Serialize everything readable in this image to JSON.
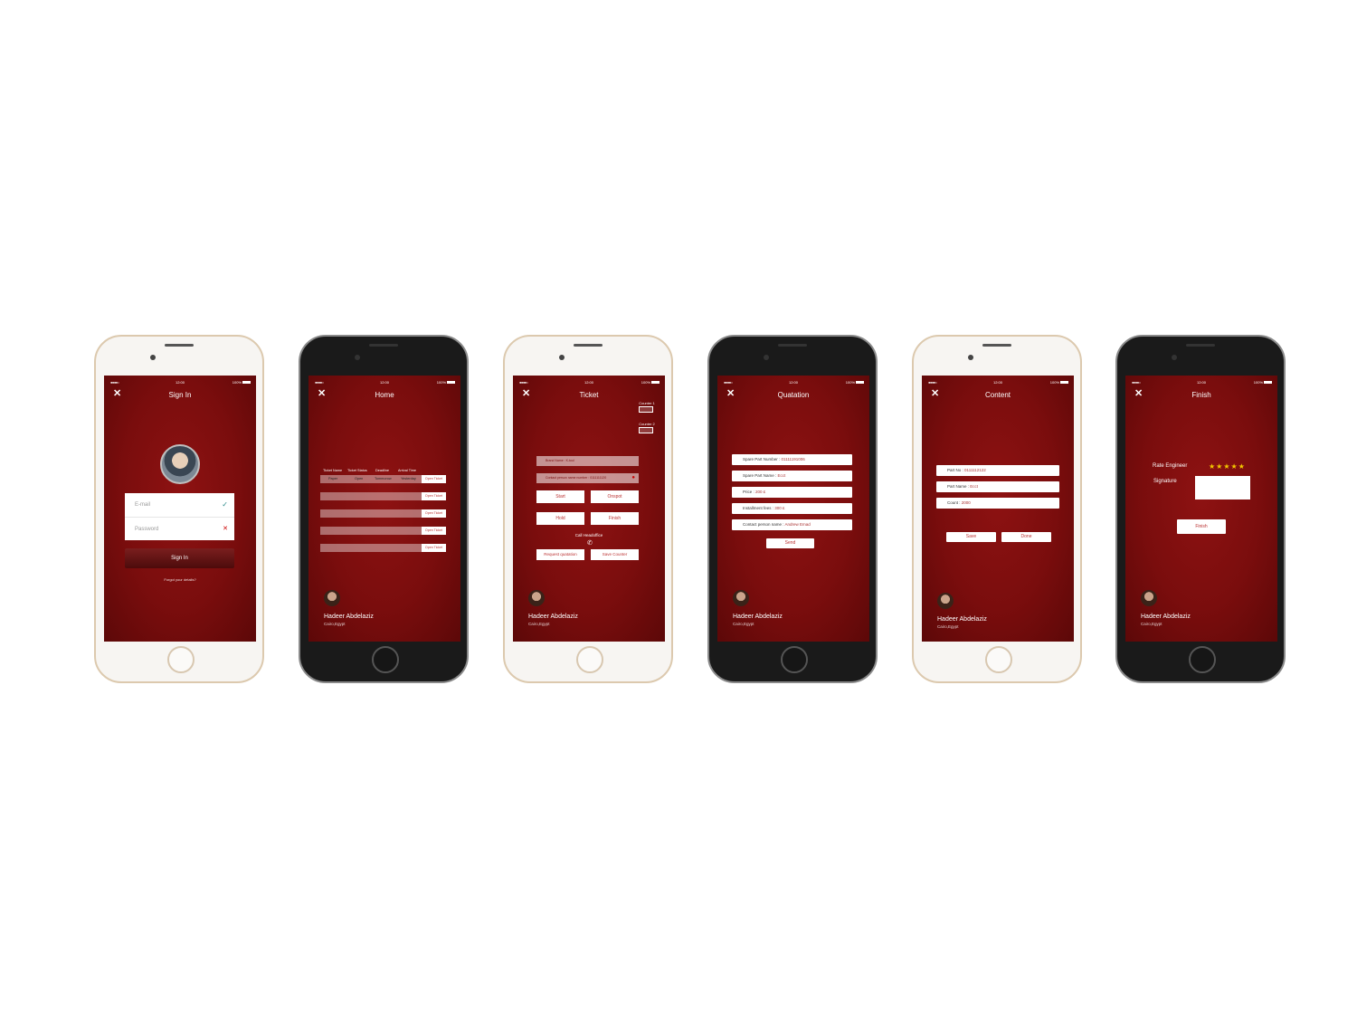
{
  "status": {
    "time": "12:00",
    "battery": "100%"
  },
  "user": {
    "name": "Hadeer Abdelaziz",
    "location": "Cairo,Egypt"
  },
  "signin": {
    "title": "Sign In",
    "email_placeholder": "E-mail",
    "password_placeholder": "Password",
    "button": "Sign In",
    "forgot": "Forgot your details?"
  },
  "home": {
    "title": "Home",
    "columns": [
      "Ticket Name",
      "Ticket Status",
      "Deadline",
      "Arrival Time"
    ],
    "first_row": [
      "Paper",
      "Open",
      "Tommorow",
      "Yesterday"
    ],
    "open_label": "Open Ticket"
  },
  "ticket": {
    "title": "Ticket",
    "counter1": "Counter 1",
    "counter2": "Counter 2",
    "brand_label": "Brand Name :",
    "brand_value": "K-tool",
    "contact_label": "Contact person name number :",
    "contact_value": "0111111120",
    "start": "Start",
    "onspot": "Onspot",
    "hold": "Hold",
    "finish": "Finish",
    "call": "Call Headoffice",
    "request": "Request quatation",
    "save_counter": "Save Counter"
  },
  "quotation": {
    "title": "Quatation",
    "fields": [
      {
        "label": "Spare Part Number :",
        "value": "01111191006"
      },
      {
        "label": "Spare Part Name :",
        "value": "Ecct"
      },
      {
        "label": "Price :",
        "value": "200 £"
      },
      {
        "label": "Installment fees :",
        "value": "300 £"
      },
      {
        "label": "Contact person name :",
        "value": "Andrew Emad"
      }
    ],
    "send": "Send"
  },
  "content": {
    "title": "Content",
    "fields": [
      {
        "label": "Part No :",
        "value": "0111112122"
      },
      {
        "label": "Part Name :",
        "value": "Ecct"
      },
      {
        "label": "Count :",
        "value": "2000"
      }
    ],
    "save": "Save",
    "done": "Done"
  },
  "finish": {
    "title": "Finish",
    "rate_label": "Rate Engineer",
    "stars": "★★★★★",
    "signature_label": "Signature",
    "button": "Finish"
  }
}
